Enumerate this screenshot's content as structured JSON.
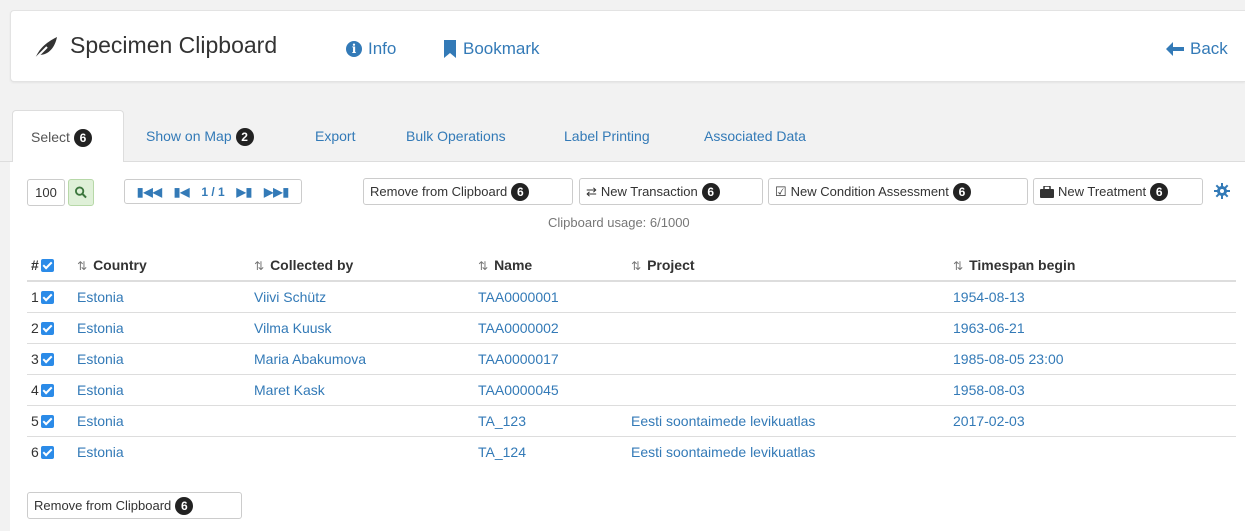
{
  "header": {
    "title": "Specimen Clipboard",
    "info_label": "Info",
    "bookmark_label": "Bookmark",
    "back_label": "Back",
    "icons": {
      "title": "leaf-icon",
      "info": "info-circle-icon",
      "bookmark": "bookmark-icon",
      "back": "arrow-left-icon"
    }
  },
  "tabs": [
    {
      "label": "Select",
      "badge": "6"
    },
    {
      "label": "Show on Map",
      "badge": "2"
    },
    {
      "label": "Export"
    },
    {
      "label": "Bulk Operations"
    },
    {
      "label": "Label Printing"
    },
    {
      "label": "Associated Data"
    }
  ],
  "toolbar": {
    "page_size": "100",
    "pager_text": "1 / 1",
    "remove_label": "Remove from Clipboard",
    "remove_badge": "6",
    "new_transaction_label": "New Transaction",
    "new_transaction_badge": "6",
    "new_condition_label": "New Condition Assessment",
    "new_condition_badge": "6",
    "new_treatment_label": "New Treatment",
    "new_treatment_badge": "6",
    "usage": "Clipboard usage: 6/1000"
  },
  "table": {
    "columns": [
      "#",
      "Country",
      "Collected by",
      "Name",
      "Project",
      "Timespan begin"
    ],
    "rows": [
      {
        "num": "1",
        "country": "Estonia",
        "collected_by": "Viivi Schütz",
        "name": "TAA0000001",
        "project": "",
        "timespan": "1954-08-13"
      },
      {
        "num": "2",
        "country": "Estonia",
        "collected_by": "Vilma Kuusk",
        "name": "TAA0000002",
        "project": "",
        "timespan": "1963-06-21"
      },
      {
        "num": "3",
        "country": "Estonia",
        "collected_by": "Maria Abakumova",
        "name": "TAA0000017",
        "project": "",
        "timespan": "1985-08-05 23:00"
      },
      {
        "num": "4",
        "country": "Estonia",
        "collected_by": "Maret Kask",
        "name": "TAA0000045",
        "project": "",
        "timespan": "1958-08-03"
      },
      {
        "num": "5",
        "country": "Estonia",
        "collected_by": "",
        "name": "TA_123",
        "project": "Eesti soontaimede levikuatlas",
        "timespan": "2017-02-03"
      },
      {
        "num": "6",
        "country": "Estonia",
        "collected_by": "",
        "name": "TA_124",
        "project": "Eesti soontaimede levikuatlas",
        "timespan": ""
      }
    ]
  },
  "footer": {
    "remove_label": "Remove from Clipboard",
    "remove_badge": "6"
  },
  "colors": {
    "link": "#337ab7",
    "checkbox": "#2b8be8",
    "badge": "#222222",
    "search_button": "#dff0d8"
  }
}
